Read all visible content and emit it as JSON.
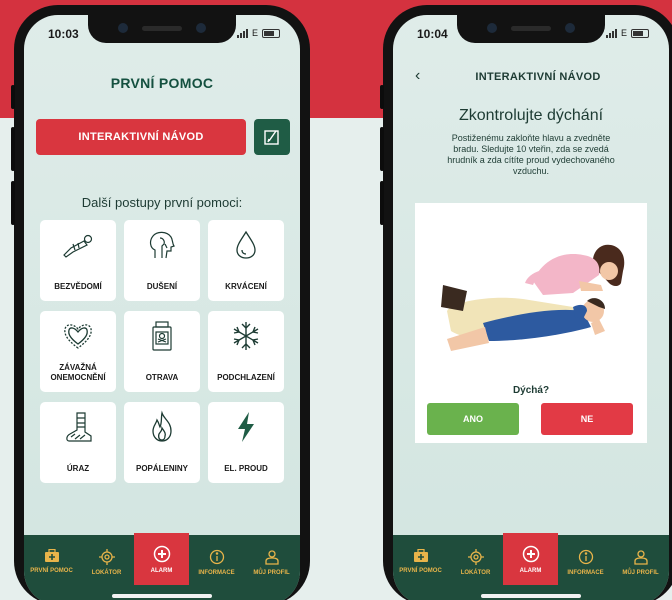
{
  "colors": {
    "brand_red": "#d9363f",
    "dark_green": "#1f4d3c",
    "nav_label": "#e8b44a",
    "yes_green": "#6ab24d"
  },
  "left_phone": {
    "status": {
      "time": "10:03",
      "carrier": "E"
    },
    "title": "PRVNÍ POMOC",
    "interactive_button": "INTERAKTIVNÍ NÁVOD",
    "subheading": "Další postupy první pomoci:",
    "tiles": [
      {
        "label": "BEZVĚDOMÍ",
        "icon": "unconscious-person-icon"
      },
      {
        "label": "DUŠENÍ",
        "icon": "choking-head-icon"
      },
      {
        "label": "KRVÁCENÍ",
        "icon": "blood-drop-icon"
      },
      {
        "label": "ZÁVAŽNÁ ONEMOCNĚNÍ",
        "icon": "heart-icon"
      },
      {
        "label": "OTRAVA",
        "icon": "poison-bottle-icon"
      },
      {
        "label": "PODCHLAZENÍ",
        "icon": "snowflake-icon"
      },
      {
        "label": "ÚRAZ",
        "icon": "bandaged-leg-icon"
      },
      {
        "label": "POPÁLENINY",
        "icon": "flame-icon"
      },
      {
        "label": "EL. PROUD",
        "icon": "lightning-icon"
      }
    ]
  },
  "nav": {
    "items": [
      {
        "label": "PRVNÍ POMOC",
        "icon": "first-aid-kit-icon"
      },
      {
        "label": "LOKÁTOR",
        "icon": "locator-icon"
      },
      {
        "label": "ALARM",
        "icon": "alarm-plus-icon"
      },
      {
        "label": "INFORMACE",
        "icon": "info-icon"
      },
      {
        "label": "MŮJ PROFIL",
        "icon": "profile-icon"
      }
    ],
    "active": "ALARM"
  },
  "right_phone": {
    "status": {
      "time": "10:04",
      "carrier": "E"
    },
    "title": "INTERAKTIVNÍ NÁVOD",
    "heading": "Zkontrolujte dýchání",
    "instructions": "Postiženému zakloňte hlavu a zvedněte bradu. Sledujte 10 vteřin, zda se zvedá hrudník a zda cítíte proud vydechovaného vzduchu.",
    "question": "Dýchá?",
    "yes_label": "ANO",
    "no_label": "NE"
  }
}
